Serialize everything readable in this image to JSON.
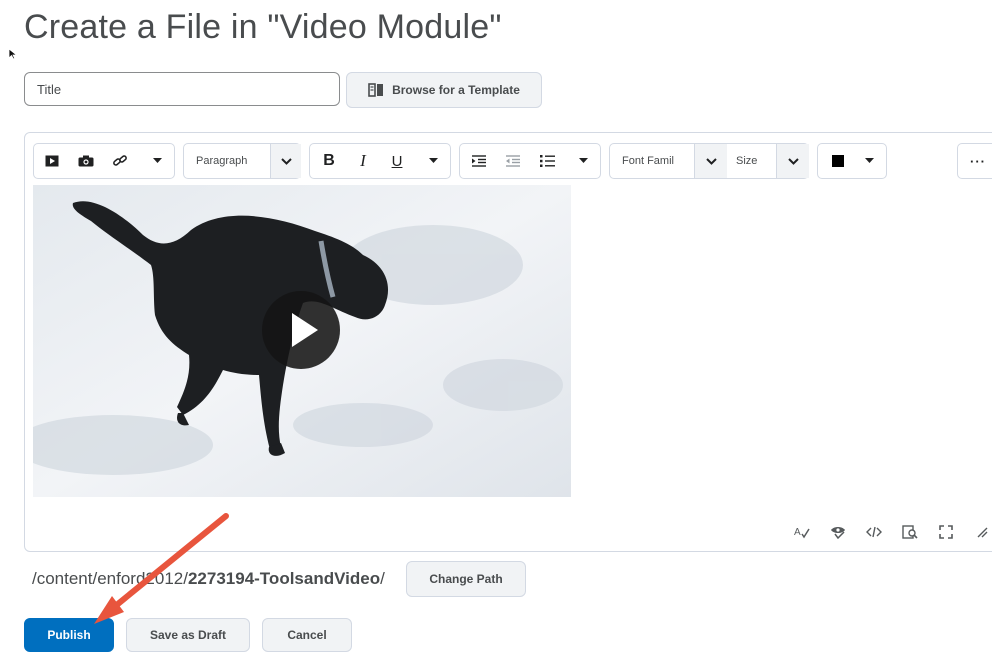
{
  "page": {
    "title": "Create a File in \"Video Module\""
  },
  "title_field": {
    "placeholder": "Title",
    "value": ""
  },
  "browse_template": {
    "label": "Browse for a Template"
  },
  "toolbar": {
    "insert_stuff_icon": "video-icon",
    "insert_image_icon": "camera-icon",
    "insert_link_icon": "link-icon",
    "format_select": "Paragraph",
    "bold_label": "B",
    "italic_label": "I",
    "underline_label": "U",
    "font_family_select": "Font Famil",
    "size_select": "Size",
    "text_color": "#000000",
    "more_label": "···"
  },
  "editor_status_icons": [
    "spellcheck-icon",
    "accessibility-checker-icon",
    "source-code-icon",
    "preview-icon",
    "fullscreen-icon",
    "resize-handle-icon"
  ],
  "path": {
    "prefix": "/content/enfor",
    "middle": "d2012/",
    "bold": "2273194-ToolsandVideo",
    "suffix": "/"
  },
  "change_path": {
    "label": "Change Path"
  },
  "actions": {
    "publish": "Publish",
    "save_draft": "Save as Draft",
    "cancel": "Cancel"
  },
  "colors": {
    "primary": "#006fbf",
    "annotation_arrow": "#e8553d",
    "border": "#d3d9e3"
  }
}
